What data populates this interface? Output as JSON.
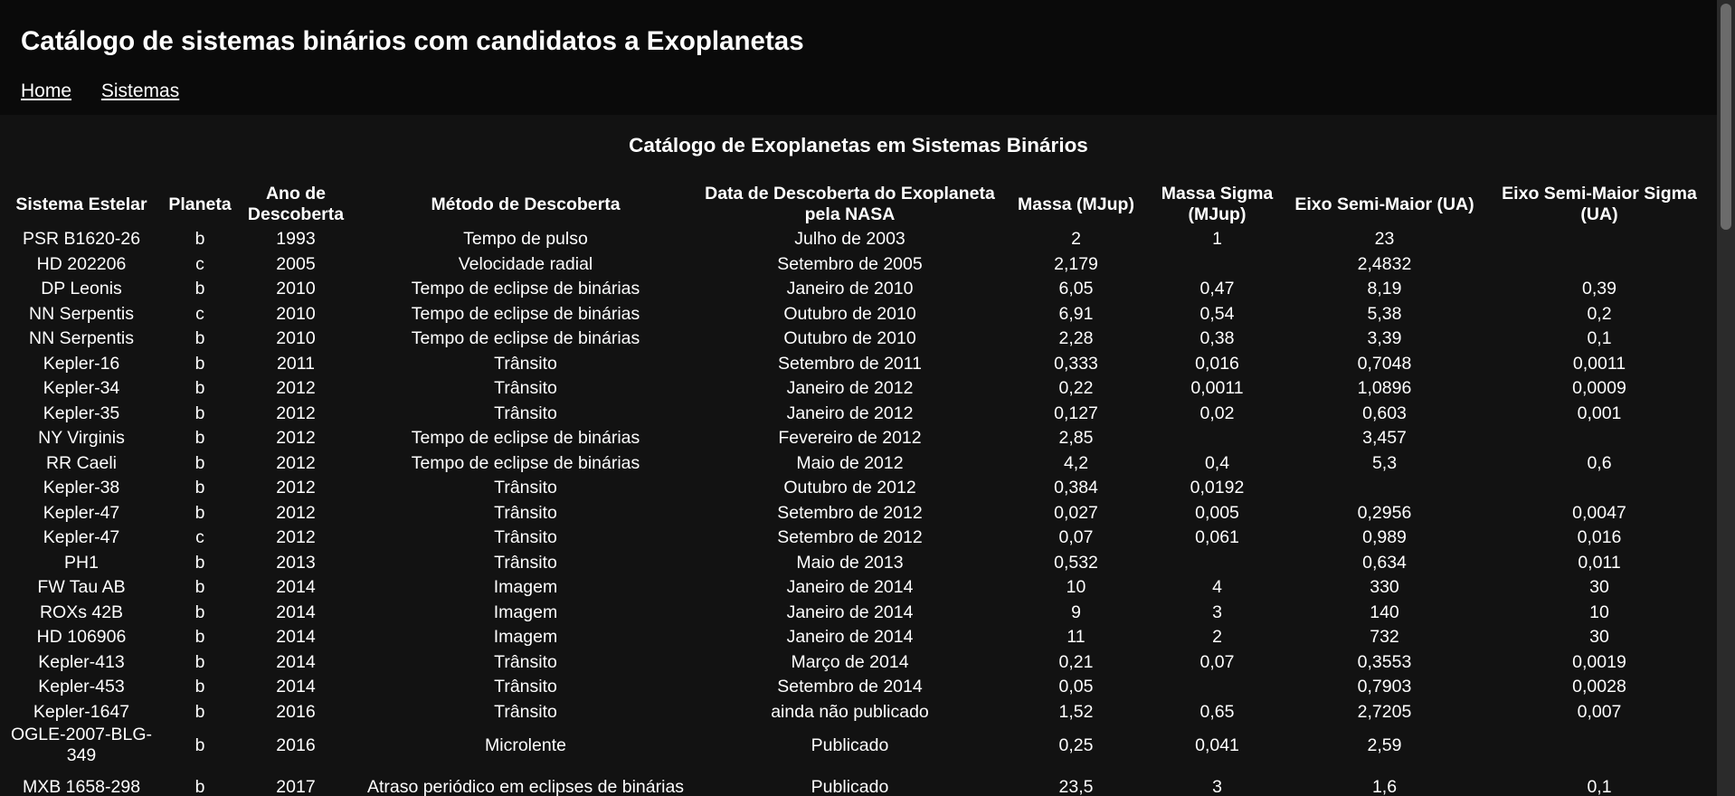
{
  "site": {
    "title": "Catálogo de sistemas binários com candidatos a Exoplanetas",
    "nav": [
      "Home",
      "Sistemas"
    ]
  },
  "table": {
    "caption": "Catálogo de Exoplanetas em Sistemas Binários",
    "headers": [
      "Sistema Estelar",
      "Planeta",
      "Ano de Descoberta",
      "Método de Descoberta",
      "Data de Descoberta do Exoplaneta pela NASA",
      "Massa (MJup)",
      "Massa Sigma (MJup)",
      "Eixo Semi-Maior (UA)",
      "Eixo Semi-Maior Sigma (UA)"
    ],
    "rows": [
      [
        "PSR B1620-26",
        "b",
        "1993",
        "Tempo de pulso",
        "Julho de 2003",
        "2",
        "1",
        "23",
        ""
      ],
      [
        "HD 202206",
        "c",
        "2005",
        "Velocidade radial",
        "Setembro de 2005",
        "2,179",
        "",
        "2,4832",
        ""
      ],
      [
        "DP Leonis",
        "b",
        "2010",
        "Tempo de eclipse de binárias",
        "Janeiro de 2010",
        "6,05",
        "0,47",
        "8,19",
        "0,39"
      ],
      [
        "NN Serpentis",
        "c",
        "2010",
        "Tempo de eclipse de binárias",
        "Outubro de 2010",
        "6,91",
        "0,54",
        "5,38",
        "0,2"
      ],
      [
        "NN Serpentis",
        "b",
        "2010",
        "Tempo de eclipse de binárias",
        "Outubro de 2010",
        "2,28",
        "0,38",
        "3,39",
        "0,1"
      ],
      [
        "Kepler-16",
        "b",
        "2011",
        "Trânsito",
        "Setembro de 2011",
        "0,333",
        "0,016",
        "0,7048",
        "0,0011"
      ],
      [
        "Kepler-34",
        "b",
        "2012",
        "Trânsito",
        "Janeiro de 2012",
        "0,22",
        "0,0011",
        "1,0896",
        "0,0009"
      ],
      [
        "Kepler-35",
        "b",
        "2012",
        "Trânsito",
        "Janeiro de 2012",
        "0,127",
        "0,02",
        "0,603",
        "0,001"
      ],
      [
        "NY Virginis",
        "b",
        "2012",
        "Tempo de eclipse de binárias",
        "Fevereiro de 2012",
        "2,85",
        "",
        "3,457",
        ""
      ],
      [
        "RR Caeli",
        "b",
        "2012",
        "Tempo de eclipse de binárias",
        "Maio de 2012",
        "4,2",
        "0,4",
        "5,3",
        "0,6"
      ],
      [
        "Kepler-38",
        "b",
        "2012",
        "Trânsito",
        "Outubro de 2012",
        "0,384",
        "0,0192",
        "",
        ""
      ],
      [
        "Kepler-47",
        "b",
        "2012",
        "Trânsito",
        "Setembro de 2012",
        "0,027",
        "0,005",
        "0,2956",
        "0,0047"
      ],
      [
        "Kepler-47",
        "c",
        "2012",
        "Trânsito",
        "Setembro de 2012",
        "0,07",
        "0,061",
        "0,989",
        "0,016"
      ],
      [
        "PH1",
        "b",
        "2013",
        "Trânsito",
        "Maio de 2013",
        "0,532",
        "",
        "0,634",
        "0,011"
      ],
      [
        "FW Tau AB",
        "b",
        "2014",
        "Imagem",
        "Janeiro de 2014",
        "10",
        "4",
        "330",
        "30"
      ],
      [
        "ROXs 42B",
        "b",
        "2014",
        "Imagem",
        "Janeiro de 2014",
        "9",
        "3",
        "140",
        "10"
      ],
      [
        "HD 106906",
        "b",
        "2014",
        "Imagem",
        "Janeiro de 2014",
        "11",
        "2",
        "732",
        "30"
      ],
      [
        "Kepler-413",
        "b",
        "2014",
        "Trânsito",
        "Março de 2014",
        "0,21",
        "0,07",
        "0,3553",
        "0,0019"
      ],
      [
        "Kepler-453",
        "b",
        "2014",
        "Trânsito",
        "Setembro de 2014",
        "0,05",
        "",
        "0,7903",
        "0,0028"
      ],
      [
        "Kepler-1647",
        "b",
        "2016",
        "Trânsito",
        "ainda não publicado",
        "1,52",
        "0,65",
        "2,7205",
        "0,007"
      ],
      [
        "OGLE-2007-BLG-349",
        "b",
        "2016",
        "Microlente",
        "Publicado",
        "0,25",
        "0,041",
        "2,59",
        ""
      ],
      [
        "MXB 1658-298",
        "b",
        "2017",
        "Atraso periódico em eclipses de binárias",
        "Publicado",
        "23,5",
        "3",
        "1,6",
        "0,1"
      ]
    ]
  }
}
